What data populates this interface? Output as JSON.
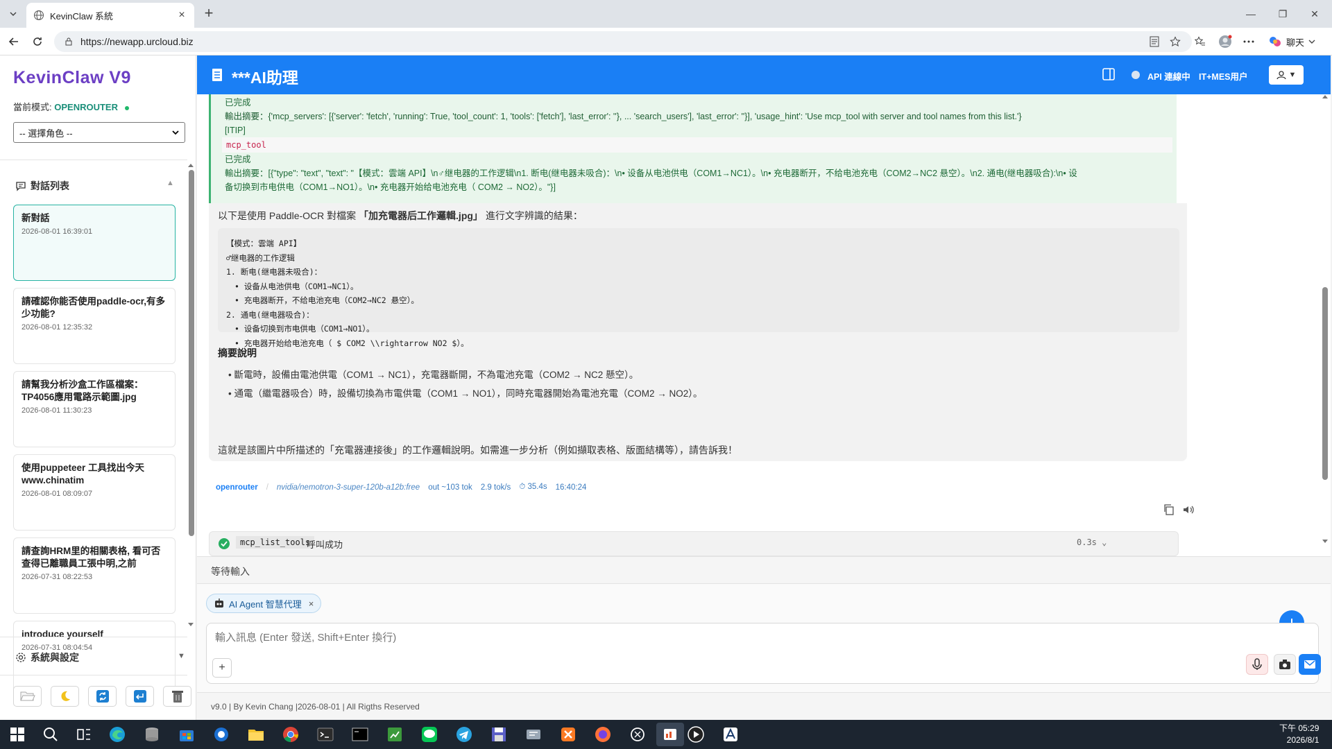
{
  "browser": {
    "tab_title": "KevinClaw 系統",
    "url": "https://newapp.urcloud.biz",
    "chat_label": "聊天"
  },
  "sidebar": {
    "brand": "KevinClaw V9",
    "mode_label": "當前模式:",
    "mode_value": "OPENROUTER",
    "role_select": "-- 選擇角色 --",
    "conversations_title": "對話列表",
    "conversations": [
      {
        "title": "新對話",
        "date": "2026-08-01 16:39:01",
        "active": true
      },
      {
        "title": "請確認你能否使用paddle-ocr,有多少功能?",
        "date": "2026-08-01 12:35:32"
      },
      {
        "title": "請幫我分析沙盒工作區檔案：TP4056應用電路示範圖.jpg",
        "date": "2026-08-01 11:30:23"
      },
      {
        "title": "使用puppeteer 工具找出今天www.chinatim",
        "date": "2026-08-01 08:09:07"
      },
      {
        "title": "請查詢HRM里的相關表格, 看可否查得已離職員工張中明,之前",
        "date": "2026-07-31 08:22:53"
      },
      {
        "title": "introduce yourself",
        "date": "2026-07-31 08:04:54"
      }
    ],
    "settings_title": "系統與設定"
  },
  "topbar": {
    "title": "***AI助理",
    "api_status": "API 連線中",
    "user_label": "IT+MES用户"
  },
  "tool_result": {
    "line1": "已完成",
    "line2": "輸出摘要：{'mcp_servers': [{'server': 'fetch', 'running': True, 'tool_count': 1, 'tools': ['fetch'], 'last_error': ''}, ... 'search_users'], 'last_error': ''}], 'usage_hint': 'Use mcp_tool with server and tool names from this list.'}",
    "line3": "[ITIP]",
    "code": "mcp_tool",
    "line4": "已完成",
    "line5": "輸出摘要：[{\"type\": \"text\", \"text\": \"【模式：雲端 API】\\n♂继电器的工作逻辑\\n1. 断电(继电器未吸合)：\\n• 设备从电池供电（COM1→NC1）。\\n• 充电器断开，不给电池充电（COM2→NC2 悬空）。\\n2. 通电(继电器吸合):\\n• 设",
    "line6": "备切换到市电供电（COM1→NO1）。\\n• 充电器开始给电池充电（ COM2 → NO2）。\"}]"
  },
  "message": {
    "intro_prefix": "以下是使用 Paddle-OCR 對檔案",
    "intro_file": "「加充電器后工作邏輯.jpg」",
    "intro_suffix": "進行文字辨識的結果：",
    "ocr_lines": [
      "【模式：雲端 API】",
      "♂继电器的工作逻辑",
      "1. 断电(继电器未吸合)：",
      "• 设备从电池供电（COM1→NC1）。",
      "• 充电器断开，不给电池充电（COM2→NC2 悬空）。",
      "2. 通电(继电器吸合)：",
      "• 设备切换到市电供电（COM1→NO1）。",
      "• 充电器开始给电池充电（ $ COM2 \\\\rightarrow NO2 $）。"
    ],
    "summary_title": "摘要說明",
    "summary_items": [
      "斷電時，設備由電池供電（COM1 → NC1），充電器斷開，不為電池充電（COM2 → NC2 懸空）。",
      "通電（繼電器吸合）時，設備切換為市電供電（COM1 → NO1），同時充電器開始為電池充電（COM2 → NO2）。"
    ],
    "closing": "這就是該圖片中所描述的「充電器連接後」的工作邏輯說明。如需進一步分析（例如擷取表格、版面結構等），請告訴我！"
  },
  "meta": {
    "provider": "openrouter",
    "model": "nvidia/nemotron-3-super-120b-a12b:free",
    "tokens": "out ~103 tok",
    "speed": "2.9 tok/s",
    "duration": "35.4s",
    "time": "16:40:24"
  },
  "mcp_call": {
    "name": "mcp_list_tools",
    "status": "呼叫成功",
    "time": "0.3s"
  },
  "status_text": "等待輸入",
  "composer": {
    "agent_chip": "AI Agent 智慧代理",
    "placeholder": "輸入訊息 (Enter 發送, Shift+Enter 換行)"
  },
  "footer": "v9.0 | By Kevin Chang |2026-08-01 | All Rigths Reserved",
  "clock": {
    "time": "下午 05:29",
    "date": "2026/8/1"
  },
  "colors": {
    "accent": "#1a7ff5",
    "success": "#3cb371",
    "brand": "#6c3fc4"
  }
}
